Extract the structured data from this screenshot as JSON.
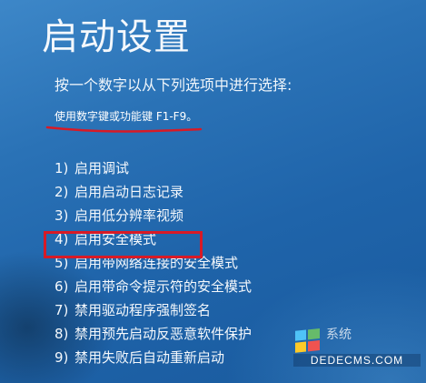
{
  "screen": {
    "title": "启动设置",
    "instruction": "按一个数字以从下列选项中进行选择:",
    "hint": "使用数字键或功能键 F1-F9。"
  },
  "options": [
    {
      "number": "1)",
      "label": "启用调试"
    },
    {
      "number": "2)",
      "label": "启用启动日志记录"
    },
    {
      "number": "3)",
      "label": "启用低分辨率视频"
    },
    {
      "number": "4)",
      "label": "启用安全模式",
      "highlighted": true
    },
    {
      "number": "5)",
      "label": "启用带网络连接的安全模式"
    },
    {
      "number": "6)",
      "label": "启用带命令提示符的安全模式"
    },
    {
      "number": "7)",
      "label": "禁用驱动程序强制签名"
    },
    {
      "number": "8)",
      "label": "禁用预先启动反恶意软件保护"
    },
    {
      "number": "9)",
      "label": "禁用失败后自动重新启动"
    }
  ],
  "watermark": {
    "brand": "系统",
    "site": "DEDECMS.COM",
    "icon": "windows-logo-icon"
  },
  "colors": {
    "background": "#2a72b6",
    "text": "#ffffff",
    "annotation_red": "#d81a26"
  }
}
